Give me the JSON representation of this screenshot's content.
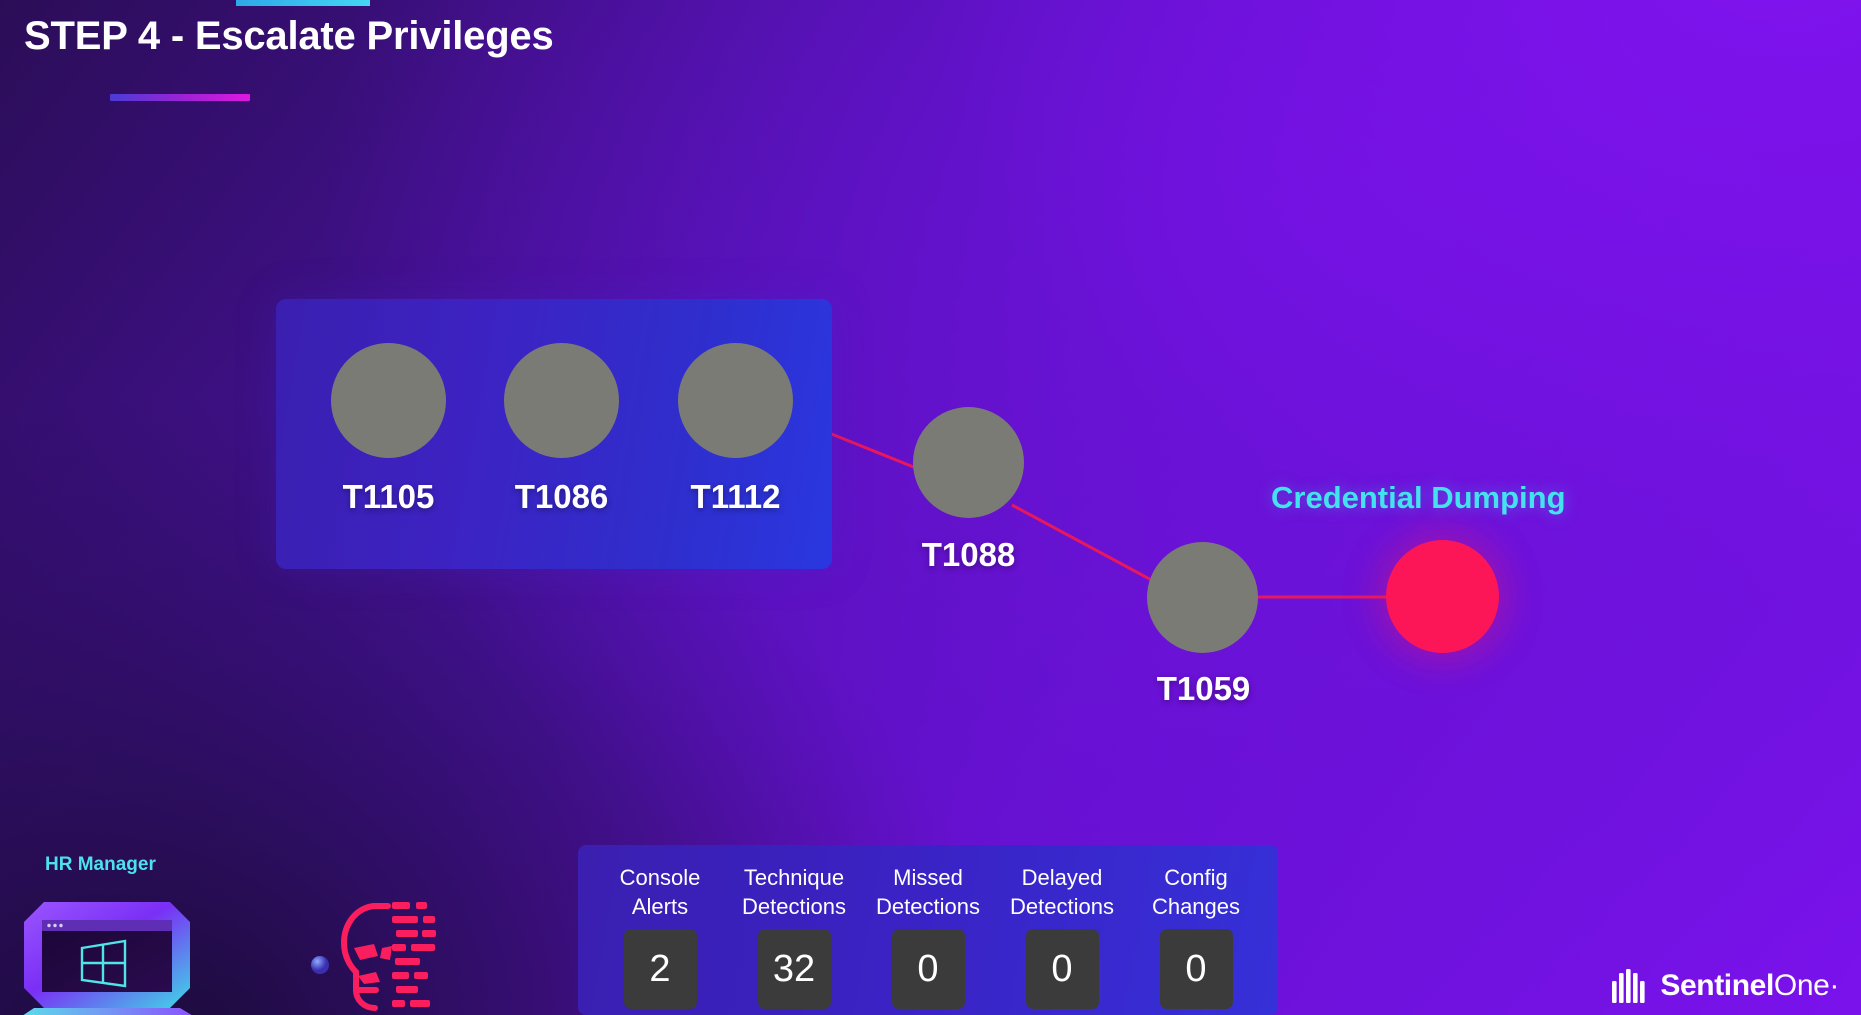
{
  "page": {
    "title": "STEP 4 - Escalate Privileges",
    "background_colors": {
      "top_right": "#7a12ec",
      "bottom_left": "#1b0b38",
      "accent_cyan": "#45d7f3",
      "accent_magenta": "#e018e0"
    }
  },
  "attack_chain": {
    "panel_nodes": [
      {
        "id": "T1105",
        "color": "#7b7b76"
      },
      {
        "id": "T1086",
        "color": "#7b7b76"
      },
      {
        "id": "T1112",
        "color": "#7b7b76"
      }
    ],
    "chain_nodes": [
      {
        "id": "T1088",
        "color": "#7b7b76"
      },
      {
        "id": "T1059",
        "color": "#7b7b76"
      }
    ],
    "outcome": {
      "label": "Credential Dumping",
      "color": "#44e2ef",
      "node_color": "#fc1658"
    },
    "link_color": "#e8185c"
  },
  "endpoint": {
    "label": "HR Manager",
    "label_color": "#4fe0ef",
    "device_icon": "windows-laptop-icon",
    "attacker_icon": "skull-hacker-icon",
    "link_icon": "dashed-connection-icon"
  },
  "stats": {
    "columns": [
      {
        "label": "Console\nAlerts",
        "value": "2"
      },
      {
        "label": "Technique\nDetections",
        "value": "32"
      },
      {
        "label": "Missed\nDetections",
        "value": "0"
      },
      {
        "label": "Delayed\nDetections",
        "value": "0"
      },
      {
        "label": "Config\nChanges",
        "value": "0"
      }
    ]
  },
  "brand": {
    "name_part1": "Sentinel",
    "name_part2": "One",
    "trademark": "·"
  }
}
